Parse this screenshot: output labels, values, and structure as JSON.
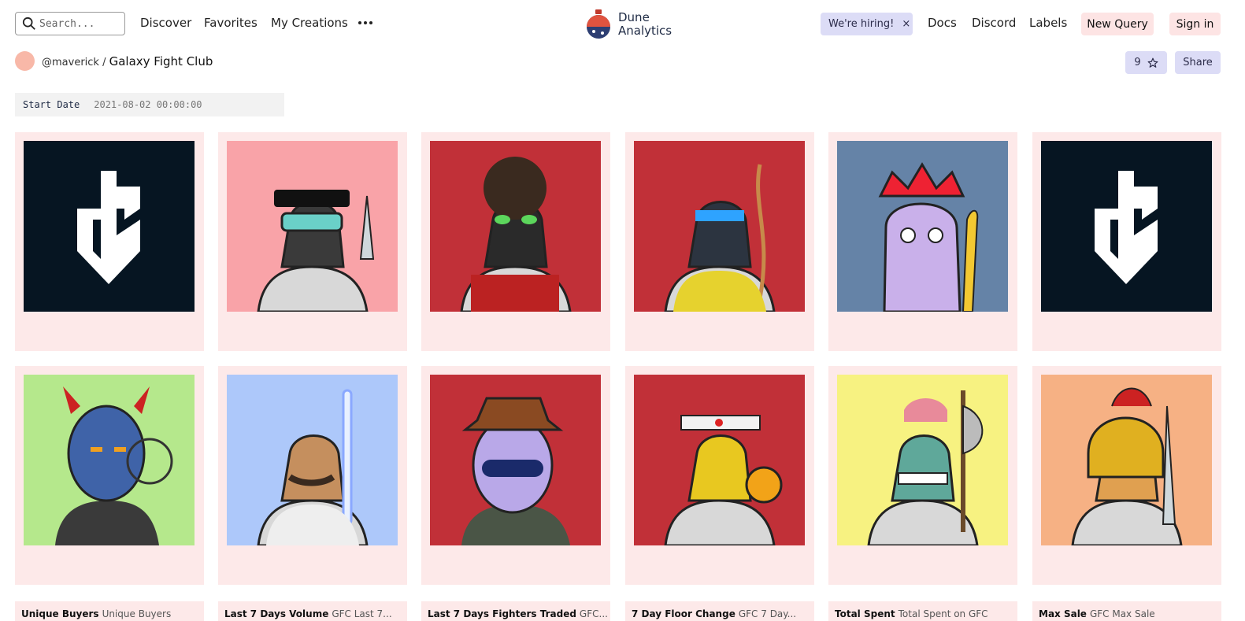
{
  "header": {
    "search_placeholder": "Search...",
    "nav": [
      "Discover",
      "Favorites",
      "My Creations"
    ],
    "brand_line1": "Dune",
    "brand_line2": "Analytics",
    "hiring_label": "We're hiring!",
    "hiring_close": "×",
    "docs": "Docs",
    "discord": "Discord",
    "labels": "Labels",
    "new_query": "New Query",
    "sign_in": "Sign in"
  },
  "dashboard": {
    "author": "@maverick /",
    "title": "Galaxy Fight Club",
    "stars": "9",
    "share": "Share"
  },
  "parameter": {
    "label": "Start Date",
    "value": "2021-08-02 00:00:00"
  },
  "cards": [
    {
      "icon": "gfc-logo",
      "bg": "#061522"
    },
    {
      "icon": "fighter-goggles-dagger",
      "bg": "#f9a3a8"
    },
    {
      "icon": "fighter-demon-guard",
      "bg": "#c13038"
    },
    {
      "icon": "fighter-helmet-whip",
      "bg": "#c13038"
    },
    {
      "icon": "fighter-purple-king",
      "bg": "#6583a7"
    },
    {
      "icon": "gfc-logo",
      "bg": "#061522"
    },
    {
      "icon": "fighter-blue-alien",
      "bg": "#b5e88c"
    },
    {
      "icon": "fighter-lightsaber",
      "bg": "#adc8fa"
    },
    {
      "icon": "fighter-fedora-robot",
      "bg": "#c13038"
    },
    {
      "icon": "fighter-headband-bitcoin",
      "bg": "#c13038"
    },
    {
      "icon": "fighter-zombie-axe",
      "bg": "#f7f281"
    },
    {
      "icon": "fighter-gladiator-sword",
      "bg": "#f6b184"
    }
  ],
  "widgets": [
    {
      "title": "Unique Buyers",
      "subtitle": "Unique Buyers"
    },
    {
      "title": "Last 7 Days Volume",
      "subtitle": "GFC Last 7..."
    },
    {
      "title": "Last 7 Days Fighters Traded",
      "subtitle": "GFC..."
    },
    {
      "title": "7 Day Floor Change",
      "subtitle": "GFC 7 Day..."
    },
    {
      "title": "Total Spent",
      "subtitle": "Total Spent on GFC"
    },
    {
      "title": "Max Sale",
      "subtitle": "GFC Max Sale"
    }
  ],
  "colors": {
    "card_bg": "#fde9e9",
    "accent_lavender": "#dcdcf6",
    "accent_pink": "#fde4e4"
  }
}
